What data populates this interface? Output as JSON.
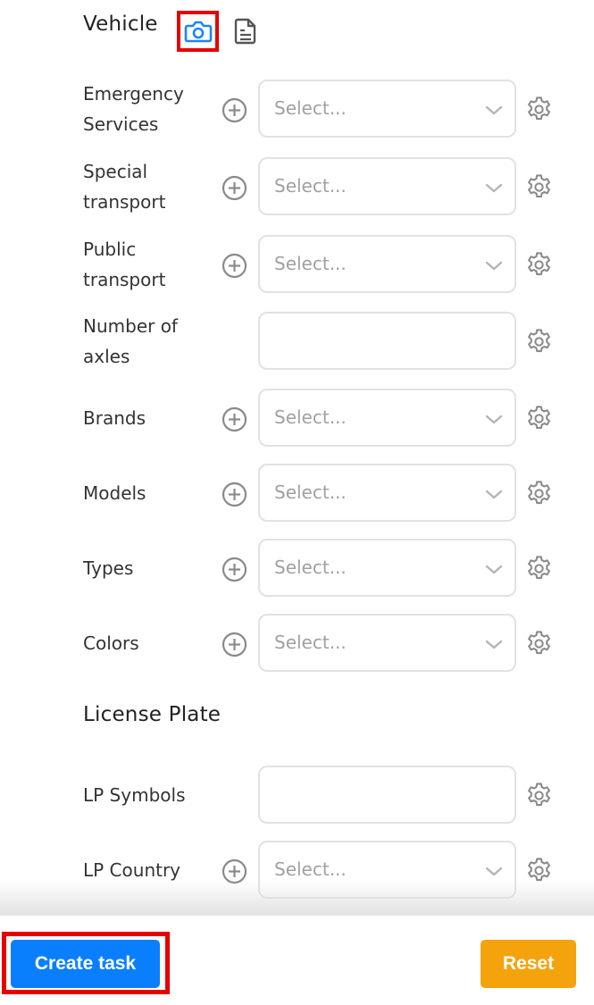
{
  "vehicle": {
    "title": "Vehicle",
    "icons": [
      "camera-icon",
      "document-icon"
    ],
    "fields": [
      {
        "label": "Emergency Services",
        "type": "select",
        "placeholder": "Select...",
        "has_add": true
      },
      {
        "label": "Special transport",
        "type": "select",
        "placeholder": "Select...",
        "has_add": true
      },
      {
        "label": "Public transport",
        "type": "select",
        "placeholder": "Select...",
        "has_add": true
      },
      {
        "label": "Number of axles",
        "type": "input",
        "value": "",
        "has_add": false
      },
      {
        "label": "Brands",
        "type": "select",
        "placeholder": "Select...",
        "has_add": true
      },
      {
        "label": "Models",
        "type": "select",
        "placeholder": "Select...",
        "has_add": true
      },
      {
        "label": "Types",
        "type": "select",
        "placeholder": "Select...",
        "has_add": true
      },
      {
        "label": "Colors",
        "type": "select",
        "placeholder": "Select...",
        "has_add": true
      }
    ]
  },
  "license_plate": {
    "title": "License Plate",
    "fields": [
      {
        "label": "LP Symbols",
        "type": "input",
        "value": "",
        "has_add": false
      },
      {
        "label": "LP Country",
        "type": "select",
        "placeholder": "Select...",
        "has_add": true
      }
    ]
  },
  "footer": {
    "create_label": "Create task",
    "reset_label": "Reset"
  },
  "colors": {
    "primary": "#0a7ffe",
    "warning": "#f5a30c",
    "highlight": "#e60000",
    "camera_icon": "#1a85ff"
  }
}
